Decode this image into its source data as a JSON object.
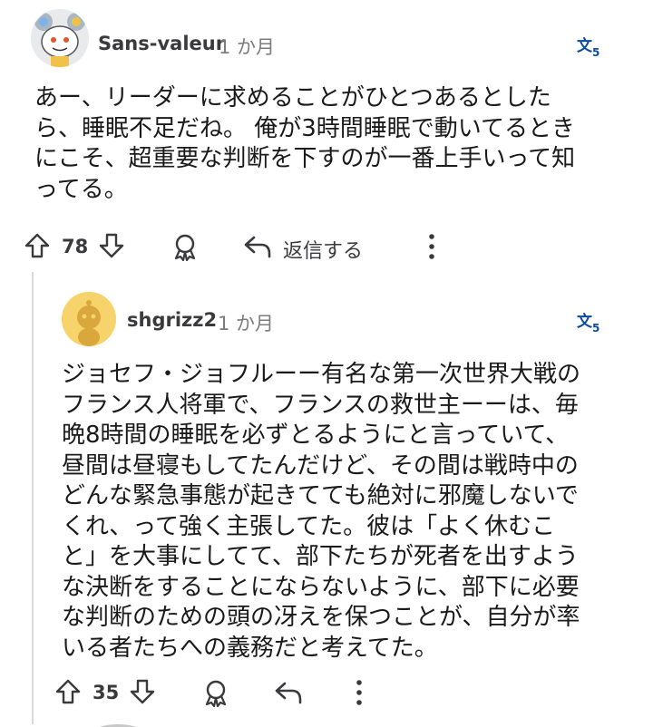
{
  "comments": [
    {
      "username": "Sans-valeur",
      "time": "1 か月",
      "body_lines": [
        "あー、リーダーに求めることがひとつあるとした",
        "ら、睡眠不足だね。 俺が3時間睡眠で動いてるとき",
        "にこそ、超重要な判断を下すのが一番上手いって知",
        "ってる。"
      ],
      "votes": "78",
      "reply_label": "返信する"
    },
    {
      "username": "shgrizz2",
      "time": "1 か月",
      "body_lines": [
        "ジョセフ・ジョフルーー有名な第一次世界大戦の",
        "フランス人将軍で、フランスの救世主ーーは、毎",
        "晩8時間の睡眠を必ずとるようにと言っていて、",
        "昼間は昼寝もしてたんだけど、その間は戦時中の",
        "どんな緊急事態が起きてても絶対に邪魔しないで",
        "くれ、って強く主張してた。彼は「よく休むこ",
        "と」を大事にしてて、部下たちが死者を出すよう",
        "な決断をすることにならないように、部下に必要",
        "な判断のための頭の冴えを保つことが、自分が率",
        "いる者たちへの義務だと考えてた。"
      ],
      "votes": "35"
    }
  ],
  "colors": {
    "accent_blue": "#0a4aa0",
    "icon_gray": "#3a3a3c",
    "avatar_yellow": "#f7d36b"
  },
  "icons": [
    "translate-icon",
    "upvote-icon",
    "downvote-icon",
    "award-icon",
    "reply-icon",
    "more-icon"
  ]
}
